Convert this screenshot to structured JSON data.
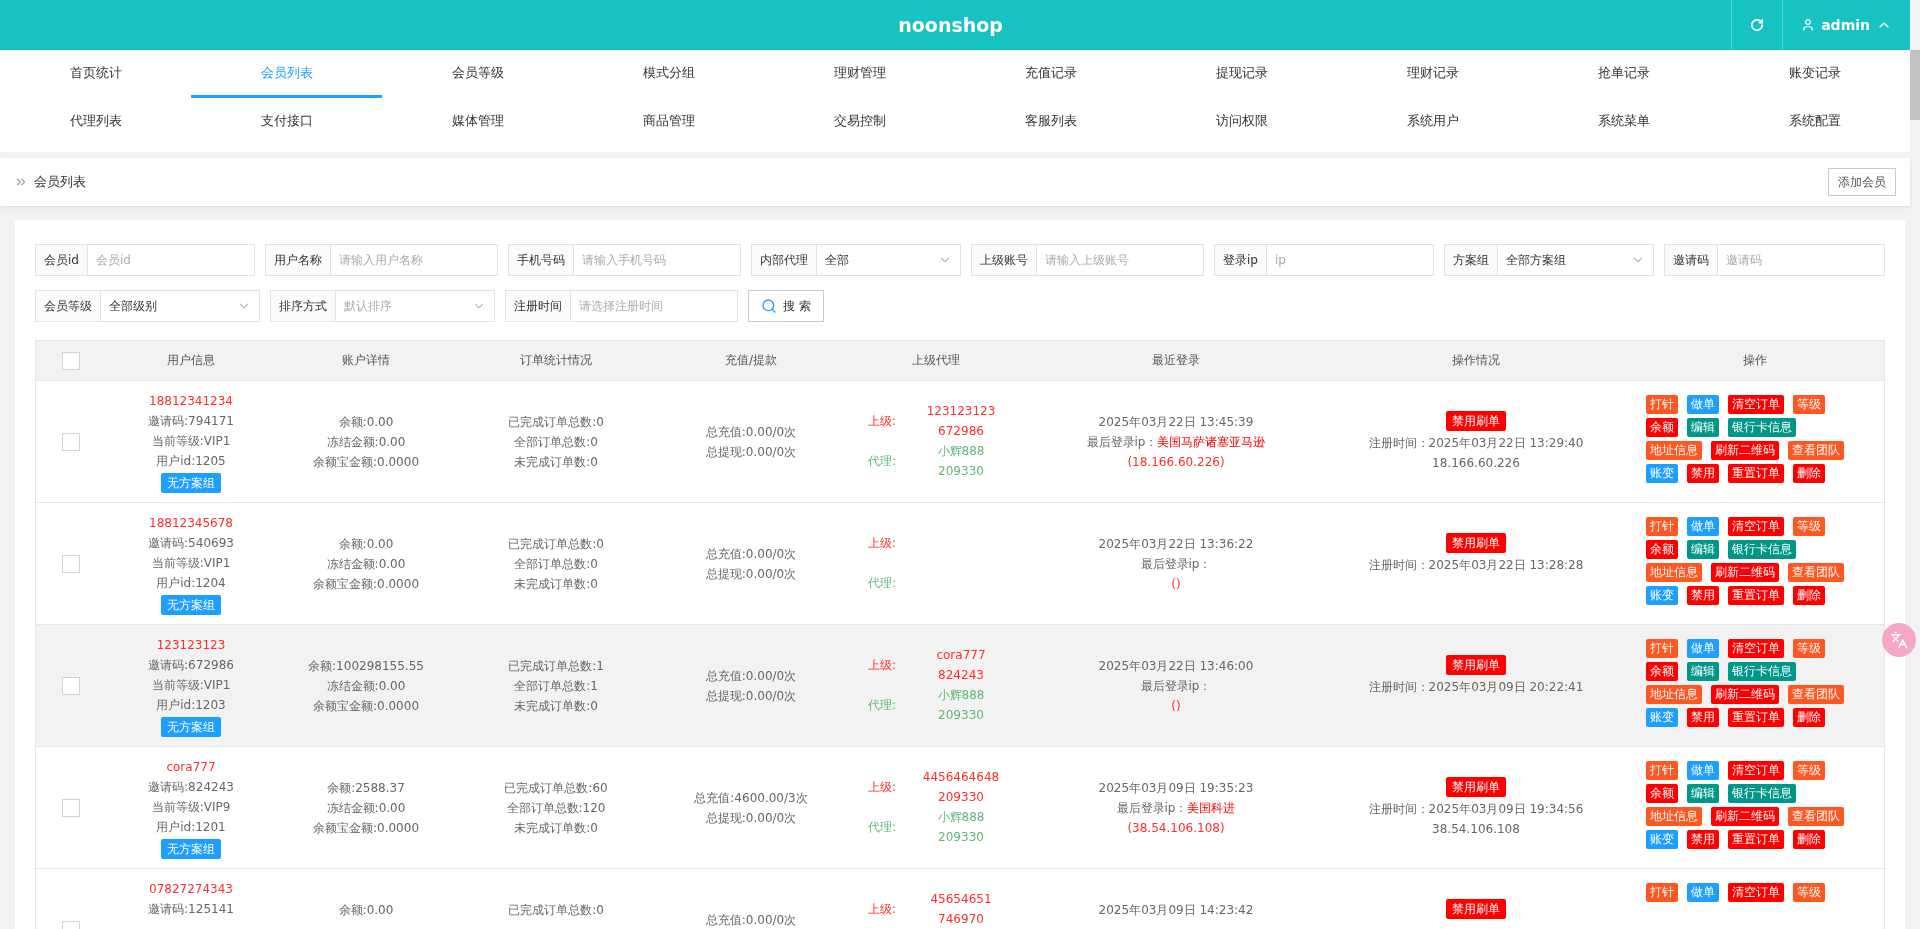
{
  "header": {
    "title": "noonshop",
    "user": "admin"
  },
  "nav": [
    {
      "label": "首页统计",
      "selected": false
    },
    {
      "label": "会员列表",
      "selected": true
    },
    {
      "label": "会员等级",
      "selected": false
    },
    {
      "label": "模式分组",
      "selected": false
    },
    {
      "label": "理财管理",
      "selected": false
    },
    {
      "label": "充值记录",
      "selected": false
    },
    {
      "label": "提现记录",
      "selected": false
    },
    {
      "label": "理财记录",
      "selected": false
    },
    {
      "label": "抢单记录",
      "selected": false
    },
    {
      "label": "账变记录",
      "selected": false
    },
    {
      "label": "代理列表",
      "selected": false
    },
    {
      "label": "支付接口",
      "selected": false
    },
    {
      "label": "媒体管理",
      "selected": false
    },
    {
      "label": "商品管理",
      "selected": false
    },
    {
      "label": "交易控制",
      "selected": false
    },
    {
      "label": "客服列表",
      "selected": false
    },
    {
      "label": "访问权限",
      "selected": false
    },
    {
      "label": "系统用户",
      "selected": false
    },
    {
      "label": "系统菜单",
      "selected": false
    },
    {
      "label": "系统配置",
      "selected": false
    }
  ],
  "breadcrumb": "会员列表",
  "add_button": "添加会员",
  "filters": [
    [
      {
        "label": "会员id",
        "kind": "input",
        "placeholder": "会员id"
      },
      {
        "label": "用户名称",
        "kind": "input",
        "placeholder": "请输入用户名称"
      },
      {
        "label": "手机号码",
        "kind": "input",
        "placeholder": "请输入手机号码"
      },
      {
        "label": "内部代理",
        "kind": "select",
        "value": "全部"
      },
      {
        "label": "上级账号",
        "kind": "input",
        "placeholder": "请输入上级账号"
      },
      {
        "label": "登录ip",
        "kind": "input",
        "placeholder": "ip"
      },
      {
        "label": "方案组",
        "kind": "select",
        "value": "全部方案组"
      },
      {
        "label": "邀请码",
        "kind": "input",
        "placeholder": "邀请码"
      }
    ],
    [
      {
        "label": "会员等级",
        "kind": "select",
        "value": "全部级别"
      },
      {
        "label": "排序方式",
        "kind": "select",
        "placeholder": "默认排序"
      },
      {
        "label": "注册时间",
        "kind": "input",
        "placeholder": "请选择注册时间"
      }
    ]
  ],
  "search_button": "搜 索",
  "table": {
    "all_checked": false,
    "columns": [
      "用户信息",
      "账户详情",
      "订单统计情况",
      "充值/提款",
      "上级代理",
      "最近登录",
      "操作情况",
      "操作"
    ],
    "rows": [
      {
        "checked": false,
        "highlighted": false,
        "phone": "18812341234",
        "invite": "邀请码:794171",
        "level": "当前等级:VIP1",
        "user_id": "用户id:1205",
        "group_tag": "无方案组",
        "balance": "余额:0.00",
        "frozen": "冻结金额:0.00",
        "yuebao": "余额宝金额:0.0000",
        "orders_done": "已完成订单总数:0",
        "orders_all": "全部订单总数:0",
        "orders_open": "未完成订单数:0",
        "recharge": "总充值:0.00/0次",
        "withdraw": "总提现:0.00/0次",
        "superior_label": "上级:",
        "superior": [
          "123123123",
          "672986"
        ],
        "agent_label": "代理:",
        "agent": [
          "小辉888",
          "209330"
        ],
        "login_time": "2025年03月22日 13:45:39",
        "login_ip_label": "最后登录ip：",
        "login_location": "美国马萨诸塞亚马逊",
        "login_ip": "(18.166.60.226)",
        "status_tag": "禁用刷单",
        "reg_time": "注册时间：2025年03月22日 13:29:40",
        "reg_ip": "18.166.60.226",
        "actions": [
          [
            {
              "label": "打针",
              "color": "#ff5722"
            },
            {
              "label": "做单",
              "color": "#1e9fff"
            },
            {
              "label": "清空订单",
              "color": "#ff0000"
            },
            {
              "label": "等级",
              "color": "#ff5722"
            }
          ],
          [
            {
              "label": "余额",
              "color": "#ff0000"
            },
            {
              "label": "编辑",
              "color": "#009688"
            },
            {
              "label": "银行卡信息",
              "color": "#009688"
            }
          ],
          [
            {
              "label": "地址信息",
              "color": "#ff5722"
            },
            {
              "label": "刷新二维码",
              "color": "#ff0000"
            },
            {
              "label": "查看团队",
              "color": "#ff5722"
            }
          ],
          [
            {
              "label": "账变",
              "color": "#1e9fff"
            },
            {
              "label": "禁用",
              "color": "#ff0000"
            },
            {
              "label": "重置订单",
              "color": "#ff0000"
            },
            {
              "label": "删除",
              "color": "#ff0000"
            }
          ]
        ]
      },
      {
        "checked": false,
        "highlighted": false,
        "phone": "18812345678",
        "invite": "邀请码:540693",
        "level": "当前等级:VIP1",
        "user_id": "用户id:1204",
        "group_tag": "无方案组",
        "balance": "余额:0.00",
        "frozen": "冻结金额:0.00",
        "yuebao": "余额宝金额:0.0000",
        "orders_done": "已完成订单总数:0",
        "orders_all": "全部订单总数:0",
        "orders_open": "未完成订单数:0",
        "recharge": "总充值:0.00/0次",
        "withdraw": "总提现:0.00/0次",
        "superior_label": "上级:",
        "agent_label": "代理:",
        "login_time": "2025年03月22日 13:36:22",
        "login_ip_label": "最后登录ip：",
        "login_ip": "()",
        "status_tag": "禁用刷单",
        "reg_time": "注册时间：2025年03月22日 13:28:28",
        "actions": [
          [
            {
              "label": "打针",
              "color": "#ff5722"
            },
            {
              "label": "做单",
              "color": "#1e9fff"
            },
            {
              "label": "清空订单",
              "color": "#ff0000"
            },
            {
              "label": "等级",
              "color": "#ff5722"
            }
          ],
          [
            {
              "label": "余额",
              "color": "#ff0000"
            },
            {
              "label": "编辑",
              "color": "#009688"
            },
            {
              "label": "银行卡信息",
              "color": "#009688"
            }
          ],
          [
            {
              "label": "地址信息",
              "color": "#ff5722"
            },
            {
              "label": "刷新二维码",
              "color": "#ff0000"
            },
            {
              "label": "查看团队",
              "color": "#ff5722"
            }
          ],
          [
            {
              "label": "账变",
              "color": "#1e9fff"
            },
            {
              "label": "禁用",
              "color": "#ff0000"
            },
            {
              "label": "重置订单",
              "color": "#ff0000"
            },
            {
              "label": "删除",
              "color": "#ff0000"
            }
          ]
        ]
      },
      {
        "checked": false,
        "highlighted": true,
        "phone": "123123123",
        "invite": "邀请码:672986",
        "level": "当前等级:VIP1",
        "user_id": "用户id:1203",
        "group_tag": "无方案组",
        "balance": "余额:100298155.55",
        "frozen": "冻结金额:0.00",
        "yuebao": "余额宝金额:0.0000",
        "orders_done": "已完成订单总数:1",
        "orders_all": "全部订单总数:1",
        "orders_open": "未完成订单数:0",
        "recharge": "总充值:0.00/0次",
        "withdraw": "总提现:0.00/0次",
        "superior_label": "上级:",
        "superior": [
          "cora777",
          "824243"
        ],
        "agent_label": "代理:",
        "agent": [
          "小辉888",
          "209330"
        ],
        "login_time": "2025年03月22日 13:46:00",
        "login_ip_label": "最后登录ip：",
        "login_ip": "()",
        "status_tag": "禁用刷单",
        "reg_time": "注册时间：2025年03月09日 20:22:41",
        "actions": [
          [
            {
              "label": "打针",
              "color": "#ff5722"
            },
            {
              "label": "做单",
              "color": "#1e9fff"
            },
            {
              "label": "清空订单",
              "color": "#ff0000"
            },
            {
              "label": "等级",
              "color": "#ff5722"
            }
          ],
          [
            {
              "label": "余额",
              "color": "#ff0000"
            },
            {
              "label": "编辑",
              "color": "#009688"
            },
            {
              "label": "银行卡信息",
              "color": "#009688"
            }
          ],
          [
            {
              "label": "地址信息",
              "color": "#ff5722"
            },
            {
              "label": "刷新二维码",
              "color": "#ff0000"
            },
            {
              "label": "查看团队",
              "color": "#ff5722"
            }
          ],
          [
            {
              "label": "账变",
              "color": "#1e9fff"
            },
            {
              "label": "禁用",
              "color": "#ff0000"
            },
            {
              "label": "重置订单",
              "color": "#ff0000"
            },
            {
              "label": "删除",
              "color": "#ff0000"
            }
          ]
        ]
      },
      {
        "checked": false,
        "highlighted": false,
        "phone": "cora777",
        "invite": "邀请码:824243",
        "level": "当前等级:VIP9",
        "user_id": "用户id:1201",
        "group_tag": "无方案组",
        "balance": "余额:2588.37",
        "frozen": "冻结金额:0.00",
        "yuebao": "余额宝金额:0.0000",
        "orders_done": "已完成订单总数:60",
        "orders_all": "全部订单总数:120",
        "orders_open": "未完成订单数:0",
        "recharge": "总充值:4600.00/3次",
        "withdraw": "总提现:0.00/0次",
        "superior_label": "上级:",
        "superior": [
          "4456464648",
          "209330"
        ],
        "agent_label": "代理:",
        "agent": [
          "小辉888",
          "209330"
        ],
        "login_time": "2025年03月09日 19:35:23",
        "login_ip_label": "最后登录ip：",
        "login_location": "美国科进",
        "login_ip": "(38.54.106.108)",
        "status_tag": "禁用刷单",
        "reg_time": "注册时间：2025年03月09日 19:34:56",
        "reg_ip": "38.54.106.108",
        "actions": [
          [
            {
              "label": "打针",
              "color": "#ff5722"
            },
            {
              "label": "做单",
              "color": "#1e9fff"
            },
            {
              "label": "清空订单",
              "color": "#ff0000"
            },
            {
              "label": "等级",
              "color": "#ff5722"
            }
          ],
          [
            {
              "label": "余额",
              "color": "#ff0000"
            },
            {
              "label": "编辑",
              "color": "#009688"
            },
            {
              "label": "银行卡信息",
              "color": "#009688"
            }
          ],
          [
            {
              "label": "地址信息",
              "color": "#ff5722"
            },
            {
              "label": "刷新二维码",
              "color": "#ff0000"
            },
            {
              "label": "查看团队",
              "color": "#ff5722"
            }
          ],
          [
            {
              "label": "账变",
              "color": "#1e9fff"
            },
            {
              "label": "禁用",
              "color": "#ff0000"
            },
            {
              "label": "重置订单",
              "color": "#ff0000"
            },
            {
              "label": "删除",
              "color": "#ff0000"
            }
          ]
        ]
      },
      {
        "checked": false,
        "highlighted": false,
        "phone": "07827274343",
        "invite": "邀请码:125141",
        "balance": "余额:0.00",
        "orders_done": "已完成订单总数:0",
        "recharge": "总充值:0.00/0次",
        "superior_label": "上级:",
        "superior": [
          "45654651",
          "746970"
        ],
        "login_time": "2025年03月09日 14:23:42",
        "status_tag": "禁用刷单",
        "actions": [
          [
            {
              "label": "打针",
              "color": "#ff5722"
            },
            {
              "label": "做单",
              "color": "#1e9fff"
            },
            {
              "label": "清空订单",
              "color": "#ff0000"
            },
            {
              "label": "等级",
              "color": "#ff5722"
            }
          ]
        ]
      }
    ]
  }
}
